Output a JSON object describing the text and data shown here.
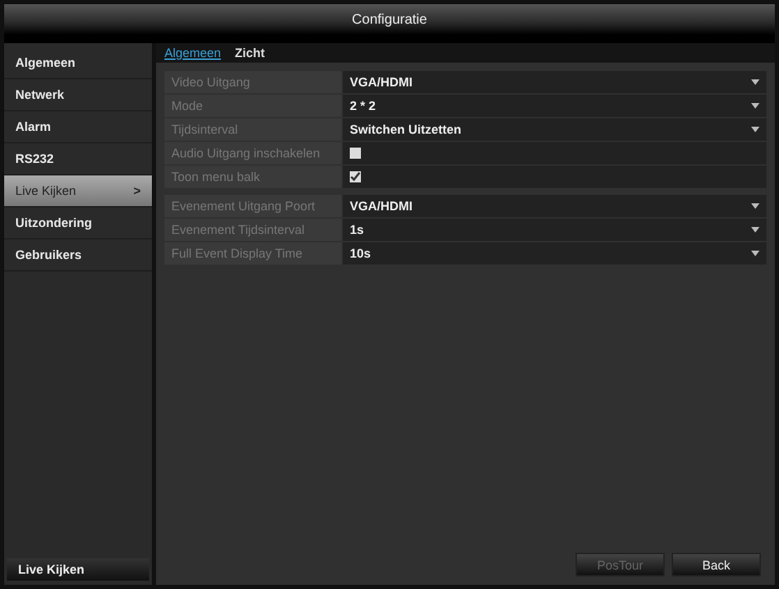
{
  "window": {
    "title": "Configuratie"
  },
  "sidebar": {
    "items": [
      {
        "label": "Algemeen",
        "selected": false
      },
      {
        "label": "Netwerk",
        "selected": false
      },
      {
        "label": "Alarm",
        "selected": false
      },
      {
        "label": "RS232",
        "selected": false
      },
      {
        "label": "Live Kijken",
        "selected": true,
        "arrow": ">"
      },
      {
        "label": "Uitzondering",
        "selected": false
      },
      {
        "label": "Gebruikers",
        "selected": false
      }
    ],
    "footer": "Live Kijken"
  },
  "tabs": [
    {
      "label": "Algemeen",
      "selected": true
    },
    {
      "label": "Zicht",
      "selected": false
    }
  ],
  "sections": [
    {
      "rows": [
        {
          "kind": "dropdown",
          "label": "Video Uitgang",
          "value": "VGA/HDMI"
        },
        {
          "kind": "dropdown",
          "label": "Mode",
          "value": "2 * 2"
        },
        {
          "kind": "dropdown",
          "label": "Tijdsinterval",
          "value": "Switchen Uitzetten"
        },
        {
          "kind": "checkbox",
          "label": "Audio Uitgang inschakelen",
          "checked": false
        },
        {
          "kind": "checkbox",
          "label": "Toon menu balk",
          "checked": true
        }
      ]
    },
    {
      "rows": [
        {
          "kind": "dropdown",
          "label": "Evenement Uitgang Poort",
          "value": "VGA/HDMI"
        },
        {
          "kind": "dropdown",
          "label": "Evenement Tijdsinterval",
          "value": "1s"
        },
        {
          "kind": "dropdown",
          "label": "Full Event Display Time",
          "value": "10s"
        }
      ]
    }
  ],
  "buttons": [
    {
      "label": "PosTour",
      "disabled": true
    },
    {
      "label": "Back",
      "disabled": false
    }
  ]
}
